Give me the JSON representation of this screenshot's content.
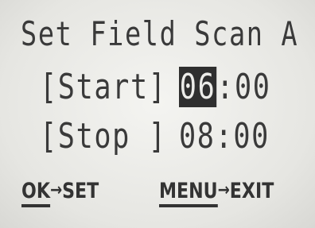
{
  "screen": {
    "title": "Set Field Scan A"
  },
  "start": {
    "label": "[Start]",
    "hour": "06",
    "separator": ":",
    "minute": "00"
  },
  "stop": {
    "label": "[Stop ]",
    "hour": "08",
    "separator": ":",
    "minute": "00"
  },
  "footer": {
    "ok_key": "OK",
    "ok_arrow": "→",
    "ok_action": "SET",
    "menu_key": "MENU",
    "menu_arrow": "→",
    "menu_action": "EXIT"
  }
}
